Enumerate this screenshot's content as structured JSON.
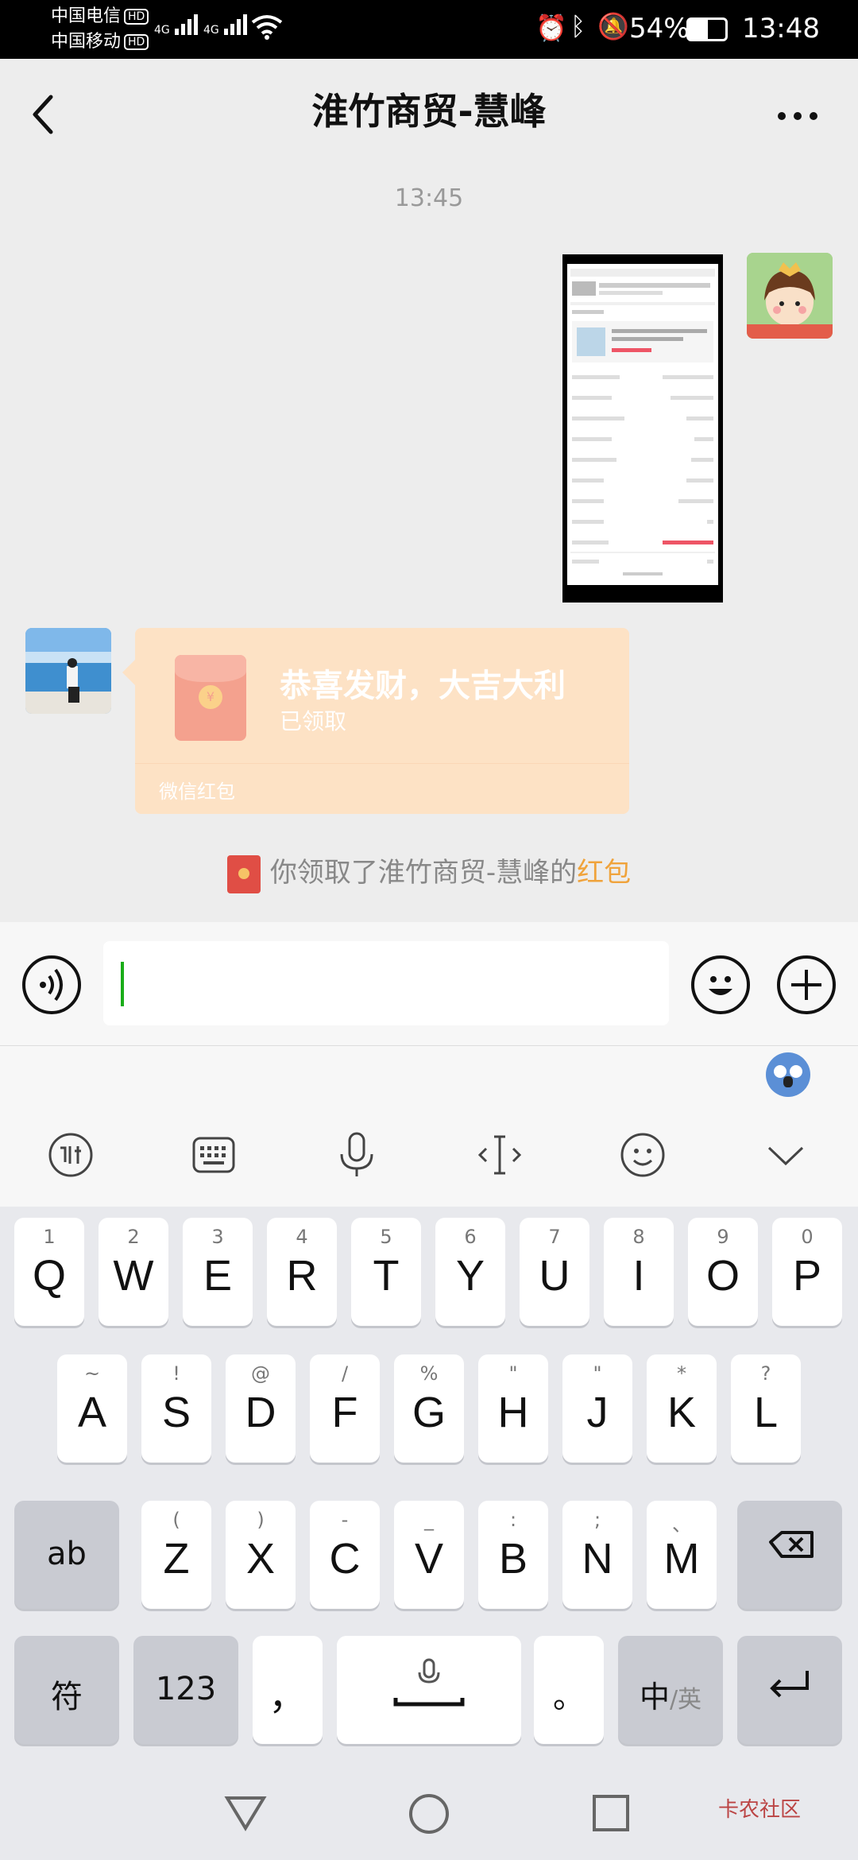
{
  "status_bar": {
    "carrier1": "中国电信",
    "carrier2": "中国移动",
    "hd": "HD",
    "net1": "4G",
    "net2": "4G",
    "battery": "54%",
    "time": "13:48"
  },
  "header": {
    "title": "淮竹商贸-慧峰",
    "back_icon": "chevron-left-icon",
    "more_icon": "ellipsis-icon"
  },
  "chat": {
    "timestamp": "13:45",
    "redpacket": {
      "title": "恭喜发财，大吉大利",
      "status": "已领取",
      "footer": "微信红包",
      "coin": "¥"
    },
    "notice": {
      "text": "你领取了淮竹商贸-慧峰的",
      "link": "红包"
    }
  },
  "input_bar": {
    "voice_icon": "voice-icon",
    "emoji_icon": "emoji-icon",
    "plus_icon": "plus-icon"
  },
  "keyboard": {
    "row1": [
      {
        "hint": "1",
        "key": "Q"
      },
      {
        "hint": "2",
        "key": "W"
      },
      {
        "hint": "3",
        "key": "E"
      },
      {
        "hint": "4",
        "key": "R"
      },
      {
        "hint": "5",
        "key": "T"
      },
      {
        "hint": "6",
        "key": "Y"
      },
      {
        "hint": "7",
        "key": "U"
      },
      {
        "hint": "8",
        "key": "I"
      },
      {
        "hint": "9",
        "key": "O"
      },
      {
        "hint": "0",
        "key": "P"
      }
    ],
    "row2": [
      {
        "hint": "~",
        "key": "A"
      },
      {
        "hint": "!",
        "key": "S"
      },
      {
        "hint": "@",
        "key": "D"
      },
      {
        "hint": "/",
        "key": "F"
      },
      {
        "hint": "%",
        "key": "G"
      },
      {
        "hint": "\"",
        "key": "H"
      },
      {
        "hint": "\"",
        "key": "J"
      },
      {
        "hint": "*",
        "key": "K"
      },
      {
        "hint": "?",
        "key": "L"
      }
    ],
    "row3": [
      {
        "hint": "(",
        "key": "Z"
      },
      {
        "hint": ")",
        "key": "X"
      },
      {
        "hint": "-",
        "key": "C"
      },
      {
        "hint": "_",
        "key": "V"
      },
      {
        "hint": ":",
        "key": "B"
      },
      {
        "hint": ";",
        "key": "N"
      },
      {
        "hint": "、",
        "key": "M"
      }
    ],
    "shift_label": "ab",
    "symbol_label": "符",
    "num_label": "123",
    "comma_label": "，",
    "period_label": "。",
    "lang_main": "中",
    "lang_alt": "/英"
  },
  "watermark": "卡农社区"
}
